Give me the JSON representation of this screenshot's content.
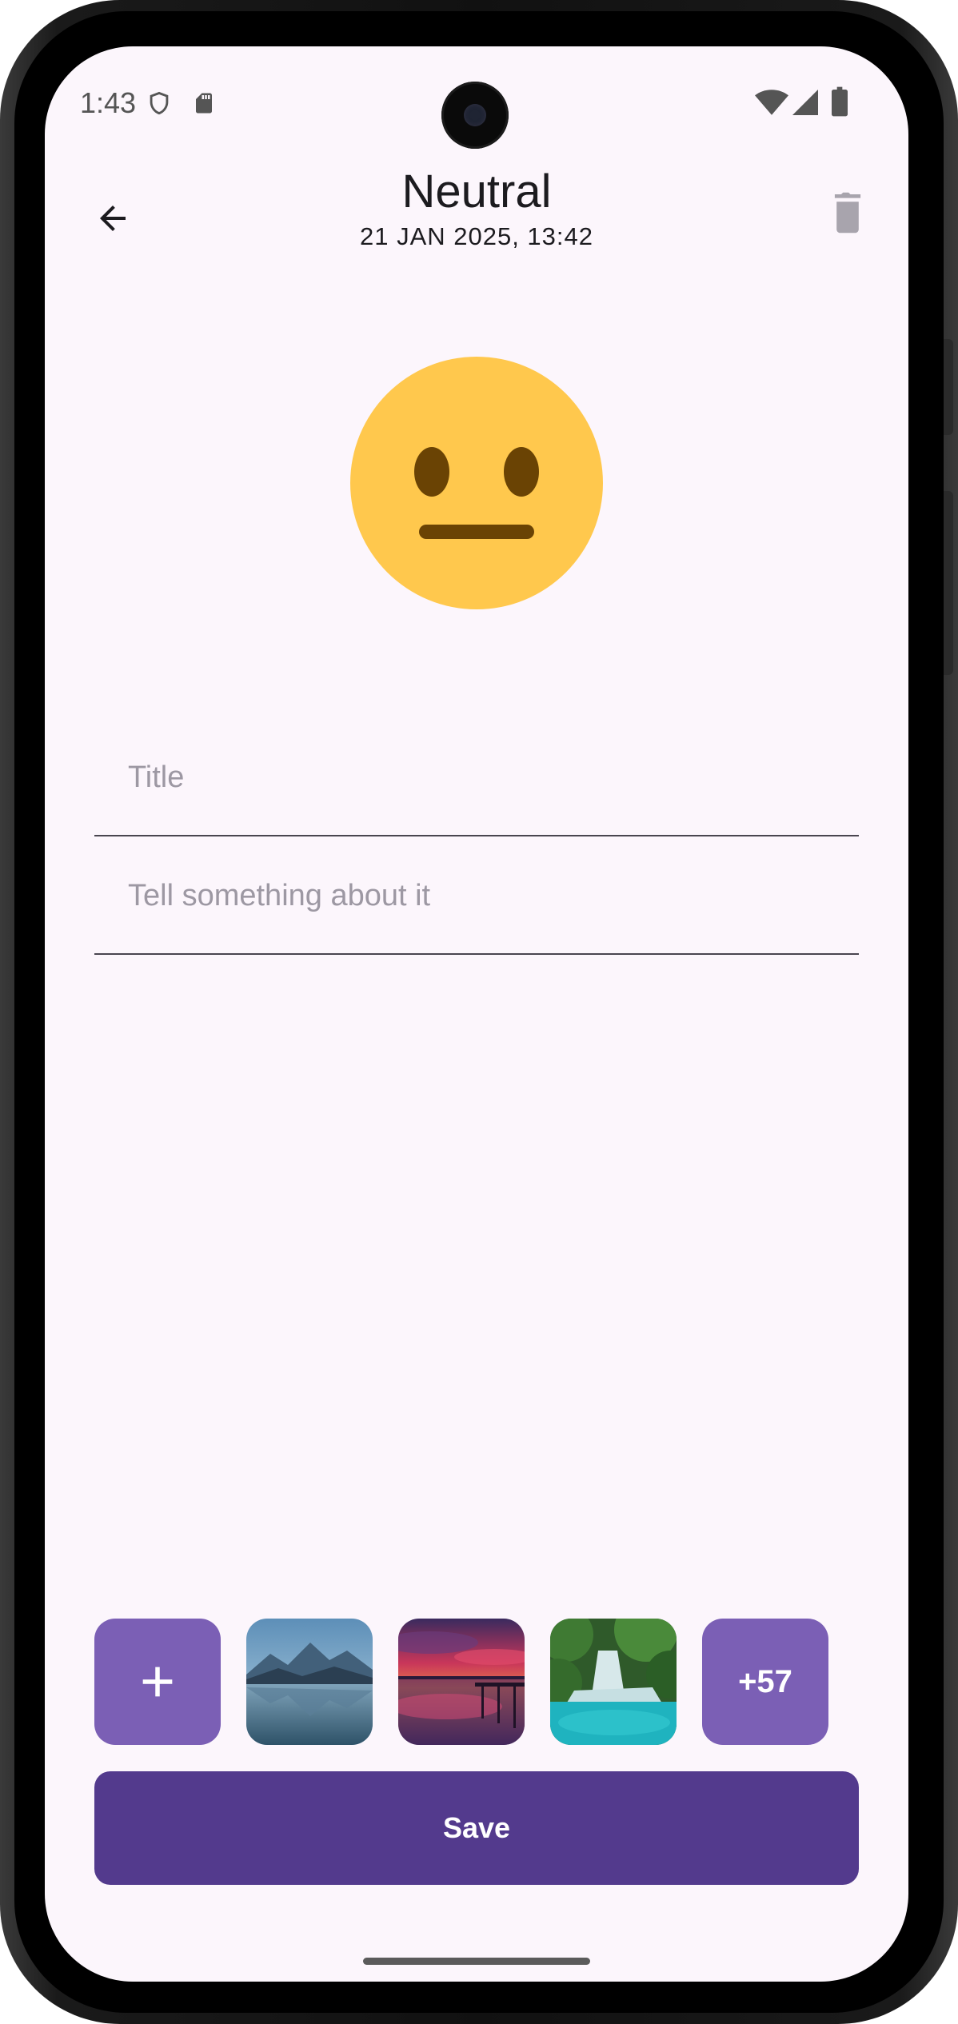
{
  "status_bar": {
    "time": "1:43"
  },
  "header": {
    "title": "Neutral",
    "date": "21 JAN 2025, 13:42"
  },
  "mood": {
    "icon": "neutral-face-icon"
  },
  "form": {
    "title_placeholder": "Title",
    "title_value": "",
    "description_placeholder": "Tell something about it",
    "description_value": ""
  },
  "attachments": {
    "add_label": "+",
    "more_count": "+57",
    "photos": [
      "mountain-lake-photo",
      "sunset-pier-photo",
      "waterfall-photo"
    ]
  },
  "actions": {
    "save_label": "Save"
  },
  "colors": {
    "background": "#fcf6fc",
    "primary": "#533a8d",
    "accent": "#7b5fb5",
    "emoji_face": "#ffc84d",
    "emoji_features": "#6a4304"
  }
}
